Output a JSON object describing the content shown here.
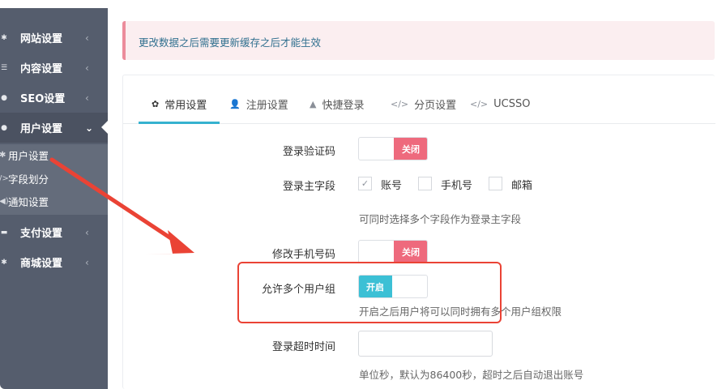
{
  "sidebar": {
    "items": [
      {
        "label": "网站设置",
        "icon": "gear-icon",
        "chevron": "‹"
      },
      {
        "label": "内容设置",
        "icon": "list-icon",
        "chevron": "‹"
      },
      {
        "label": "SEO设置",
        "icon": "globe-icon",
        "chevron": "‹"
      },
      {
        "label": "用户设置",
        "icon": "user-icon",
        "chevron": "⌄"
      },
      {
        "label": "支付设置",
        "icon": "card-icon",
        "chevron": "‹"
      },
      {
        "label": "商城设置",
        "icon": "cart-icon",
        "chevron": "‹"
      }
    ],
    "subitems": [
      {
        "label": "用户设置",
        "icon": "gear-icon"
      },
      {
        "label": "字段划分",
        "icon": "code-icon"
      },
      {
        "label": "通知设置",
        "icon": "speaker-icon"
      }
    ]
  },
  "alert": {
    "text": "更改数据之后需要更新缓存之后才能生效"
  },
  "tabs": [
    {
      "label": "常用设置",
      "icon": "gear-icon",
      "active": true
    },
    {
      "label": "注册设置",
      "icon": "user-plus-icon",
      "active": false
    },
    {
      "label": "快捷登录",
      "icon": "bell-icon",
      "active": false
    },
    {
      "label": "分页设置",
      "icon": "code-icon",
      "active": false
    },
    {
      "label": "UCSSO",
      "icon": "code-icon",
      "active": false
    }
  ],
  "form": {
    "login_captcha": {
      "label": "登录验证码",
      "state": "关闭"
    },
    "login_field": {
      "label": "登录主字段",
      "options": [
        {
          "label": "账号",
          "checked": true
        },
        {
          "label": "手机号",
          "checked": false
        },
        {
          "label": "邮箱",
          "checked": false
        }
      ],
      "help": "可同时选择多个字段作为登录主字段"
    },
    "modify_phone": {
      "label": "修改手机号码",
      "state": "关闭"
    },
    "multi_group": {
      "label": "允许多个用户组",
      "state": "开启",
      "help": "开启之后用户将可以同时拥有多个用户组权限"
    },
    "login_timeout": {
      "label": "登录超时时间",
      "value": "",
      "help": "单位秒，默认为86400秒，超时之后自动退出账号"
    }
  },
  "colors": {
    "sidebar_bg": "#555d6d",
    "accent": "#36b2cf",
    "toggle_off": "#ee6a7d",
    "toggle_on": "#3cc0d5",
    "annotation": "#ea4335"
  }
}
